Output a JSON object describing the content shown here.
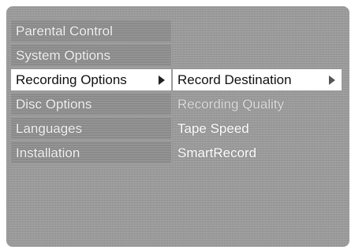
{
  "left_menu": {
    "items": [
      {
        "label": "Parental Control"
      },
      {
        "label": "System Options"
      },
      {
        "label": "Recording Options"
      },
      {
        "label": "Disc Options"
      },
      {
        "label": "Languages"
      },
      {
        "label": "Installation"
      }
    ],
    "selected": "Recording Options"
  },
  "right_menu": {
    "items": [
      {
        "label": "Record Destination"
      },
      {
        "label": "Recording Quality"
      },
      {
        "label": "Tape Speed"
      },
      {
        "label": "SmartRecord"
      }
    ],
    "selected": "Record Destination"
  },
  "icons": {
    "submenu_arrow": "triangle-right-icon"
  }
}
